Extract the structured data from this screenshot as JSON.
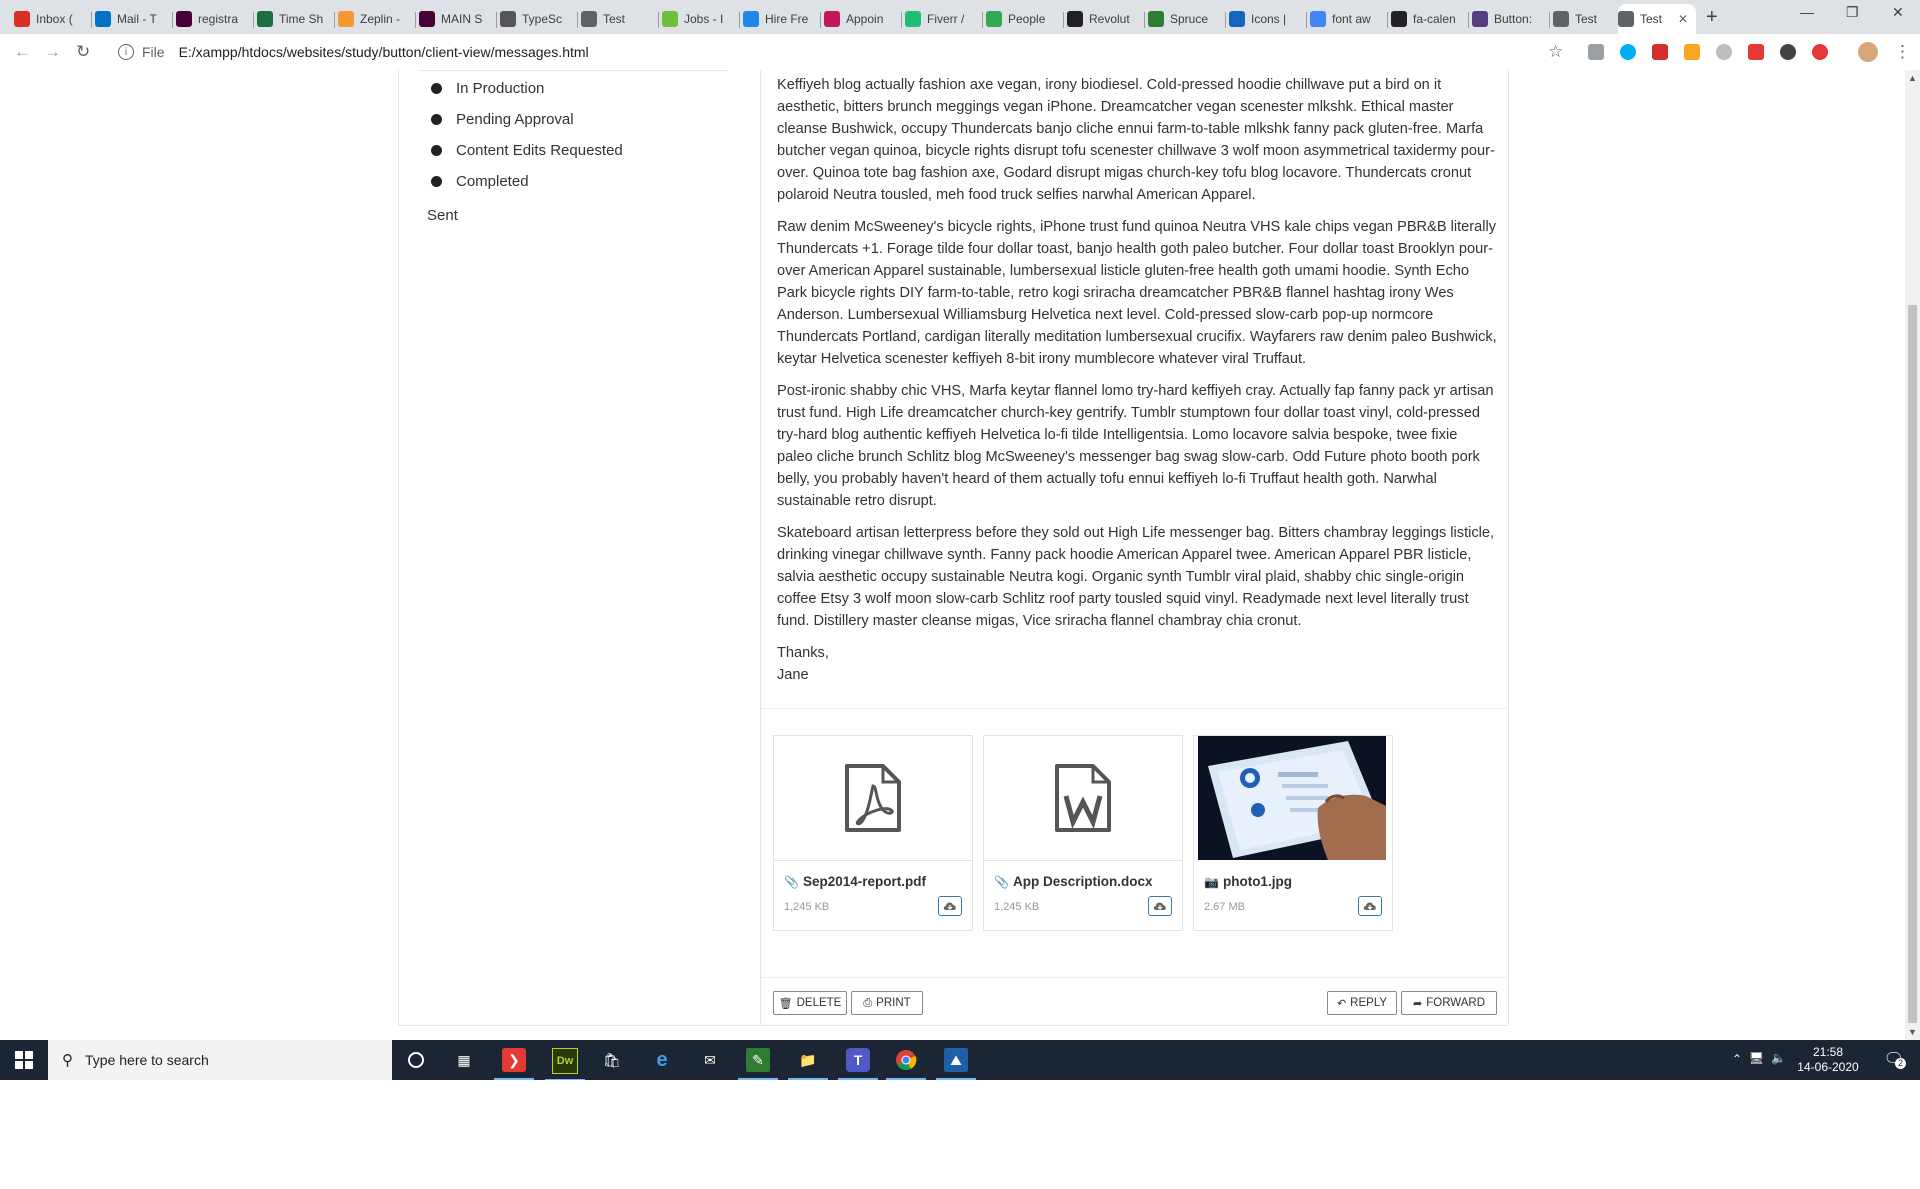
{
  "browser": {
    "tabs": [
      {
        "label": "Inbox (",
        "icon": "gmail-icon",
        "color": "#d93025"
      },
      {
        "label": "Mail - T",
        "icon": "outlook-icon",
        "color": "#0072c6"
      },
      {
        "label": "registra",
        "icon": "xd-icon",
        "color": "#470137"
      },
      {
        "label": "Time Sh",
        "icon": "excel-icon",
        "color": "#1d6f42"
      },
      {
        "label": "Zeplin -",
        "icon": "zeplin-icon",
        "color": "#f69833"
      },
      {
        "label": "MAIN S",
        "icon": "xd-icon",
        "color": "#470137"
      },
      {
        "label": "TypeSc",
        "icon": "typescale-icon",
        "color": "#555555"
      },
      {
        "label": "Test",
        "icon": "globe-icon",
        "color": "#5f6368"
      },
      {
        "label": "Jobs - I",
        "icon": "jobs-icon",
        "color": "#6fbf3b"
      },
      {
        "label": "Hire Fre",
        "icon": "hire-icon",
        "color": "#1e88e5"
      },
      {
        "label": "Appoin",
        "icon": "appointment-icon",
        "color": "#c2185b"
      },
      {
        "label": "Fiverr /",
        "icon": "fiverr-icon",
        "color": "#1dbf73"
      },
      {
        "label": "People",
        "icon": "drive-icon",
        "color": "#34a853"
      },
      {
        "label": "Revolut",
        "icon": "revolut-icon",
        "color": "#222222"
      },
      {
        "label": "Spruce",
        "icon": "spruce-icon",
        "color": "#2e7d32"
      },
      {
        "label": "Icons |",
        "icon": "icons-icon",
        "color": "#1565c0"
      },
      {
        "label": "font aw",
        "icon": "google-icon",
        "color": "#4285f4"
      },
      {
        "label": "fa-calen",
        "icon": "fa-icon",
        "color": "#222222"
      },
      {
        "label": "Button:",
        "icon": "bootstrap-icon",
        "color": "#563d7c"
      },
      {
        "label": "Test",
        "icon": "globe-icon",
        "color": "#5f6368"
      },
      {
        "label": "Test",
        "icon": "globe-icon",
        "color": "#5f6368"
      }
    ],
    "address_scheme": "File",
    "address": "E:/xampp/htdocs/websites/study/button/client-view/messages.html"
  },
  "sidebar": {
    "items": [
      {
        "label": "In Production"
      },
      {
        "label": "Pending Approval"
      },
      {
        "label": "Content Edits Requested"
      },
      {
        "label": "Completed"
      }
    ],
    "sent_label": "Sent"
  },
  "message": {
    "paragraphs": [
      "Keffiyeh blog actually fashion axe vegan, irony biodiesel. Cold-pressed hoodie chillwave put a bird on it aesthetic, bitters brunch meggings vegan iPhone. Dreamcatcher vegan scenester mlkshk. Ethical master cleanse Bushwick, occupy Thundercats banjo cliche ennui farm-to-table mlkshk fanny pack gluten-free. Marfa butcher vegan quinoa, bicycle rights disrupt tofu scenester chillwave 3 wolf moon asymmetrical taxidermy pour-over. Quinoa tote bag fashion axe, Godard disrupt migas church-key tofu blog locavore. Thundercats cronut polaroid Neutra tousled, meh food truck selfies narwhal American Apparel.",
      "Raw denim McSweeney's bicycle rights, iPhone trust fund quinoa Neutra VHS kale chips vegan PBR&B literally Thundercats +1. Forage tilde four dollar toast, banjo health goth paleo butcher. Four dollar toast Brooklyn pour-over American Apparel sustainable, lumbersexual listicle gluten-free health goth umami hoodie. Synth Echo Park bicycle rights DIY farm-to-table, retro kogi sriracha dreamcatcher PBR&B flannel hashtag irony Wes Anderson. Lumbersexual Williamsburg Helvetica next level. Cold-pressed slow-carb pop-up normcore Thundercats Portland, cardigan literally meditation lumbersexual crucifix. Wayfarers raw denim paleo Bushwick, keytar Helvetica scenester keffiyeh 8-bit irony mumblecore whatever viral Truffaut.",
      "Post-ironic shabby chic VHS, Marfa keytar flannel lomo try-hard keffiyeh cray. Actually fap fanny pack yr artisan trust fund. High Life dreamcatcher church-key gentrify. Tumblr stumptown four dollar toast vinyl, cold-pressed try-hard blog authentic keffiyeh Helvetica lo-fi tilde Intelligentsia. Lomo locavore salvia bespoke, twee fixie paleo cliche brunch Schlitz blog McSweeney's messenger bag swag slow-carb. Odd Future photo booth pork belly, you probably haven't heard of them actually tofu ennui keffiyeh lo-fi Truffaut health goth. Narwhal sustainable retro disrupt.",
      "Skateboard artisan letterpress before they sold out High Life messenger bag. Bitters chambray leggings listicle, drinking vinegar chillwave synth. Fanny pack hoodie American Apparel twee. American Apparel PBR listicle, salvia aesthetic occupy sustainable Neutra kogi. Organic synth Tumblr viral plaid, shabby chic single-origin coffee Etsy 3 wolf moon slow-carb Schlitz roof party tousled squid vinyl. Readymade next level literally trust fund. Distillery master cleanse migas, Vice sriracha flannel chambray chia cronut."
    ],
    "signoff": "Thanks,",
    "signature": "Jane"
  },
  "attachments": [
    {
      "name": "Sep2014-report.pdf",
      "size": "1,245 KB",
      "icon": "pdf-file-icon",
      "type_icon": "paperclip-icon"
    },
    {
      "name": "App Description.docx",
      "size": "1,245 KB",
      "icon": "word-file-icon",
      "type_icon": "paperclip-icon"
    },
    {
      "name": "photo1.jpg",
      "size": "2.67 MB",
      "icon": "photo-thumbnail",
      "type_icon": "camera-icon"
    }
  ],
  "actions": {
    "delete": "DELETE",
    "print": "PRINT",
    "reply": "REPLY",
    "forward": "FORWARD"
  },
  "taskbar": {
    "search_placeholder": "Type here to search",
    "time": "21:58",
    "date": "14-06-2020",
    "notifications": "2"
  },
  "colors": {
    "accent": "#337ab7",
    "taskbar": "#1b2534"
  }
}
